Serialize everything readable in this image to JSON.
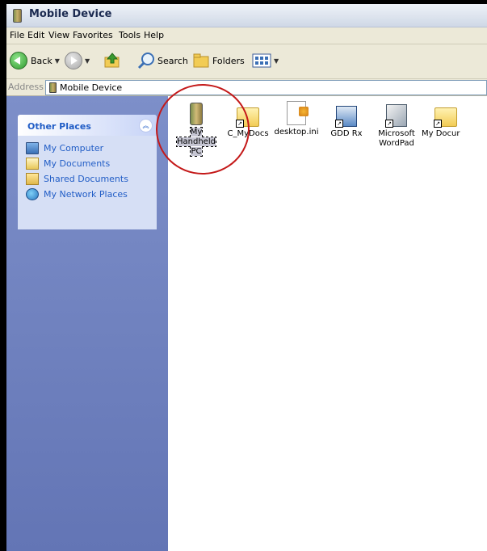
{
  "window": {
    "title": "Mobile Device"
  },
  "menu": [
    "File",
    "Edit",
    "View",
    "Favorites",
    "Tools",
    "Help"
  ],
  "toolbar": {
    "back_label": "Back",
    "search_label": "Search",
    "folders_label": "Folders"
  },
  "address": {
    "label": "Address",
    "value": "Mobile Device"
  },
  "sidebar": {
    "panel_title": "Other Places",
    "places": [
      "My Computer",
      "My Documents",
      "Shared Documents",
      "My Network Places"
    ]
  },
  "files": [
    {
      "name": "My Handheld PC",
      "icon": "handheld-icon",
      "selected": true
    },
    {
      "name": "C_MyDocs",
      "icon": "folder-shortcut-icon"
    },
    {
      "name": "desktop.ini",
      "icon": "settings-file-icon"
    },
    {
      "name": "GDD Rx",
      "icon": "app-shortcut-icon"
    },
    {
      "name": "Microsoft WordPad",
      "icon": "wordpad-shortcut-icon"
    },
    {
      "name": "My Docur",
      "icon": "folder-shortcut-icon"
    }
  ],
  "colors": {
    "callout": "#c41919",
    "sidebar": "#6f82c0",
    "link": "#215dc6"
  }
}
